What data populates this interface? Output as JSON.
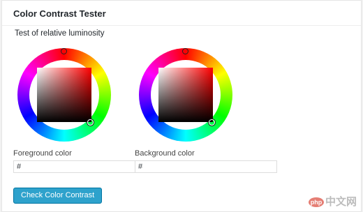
{
  "panel": {
    "title": "Color Contrast Tester",
    "subtitle": "Test of relative luminosity"
  },
  "pickers": [
    {
      "label": "Foreground color",
      "value": "#"
    },
    {
      "label": "Background color",
      "value": "#"
    }
  ],
  "actions": {
    "check_label": "Check Color Contrast"
  },
  "watermark": {
    "logo_text": "php",
    "text": "中文网"
  },
  "colors": {
    "accent": "#2ea2cc",
    "picked_hue": "#ff0000"
  }
}
